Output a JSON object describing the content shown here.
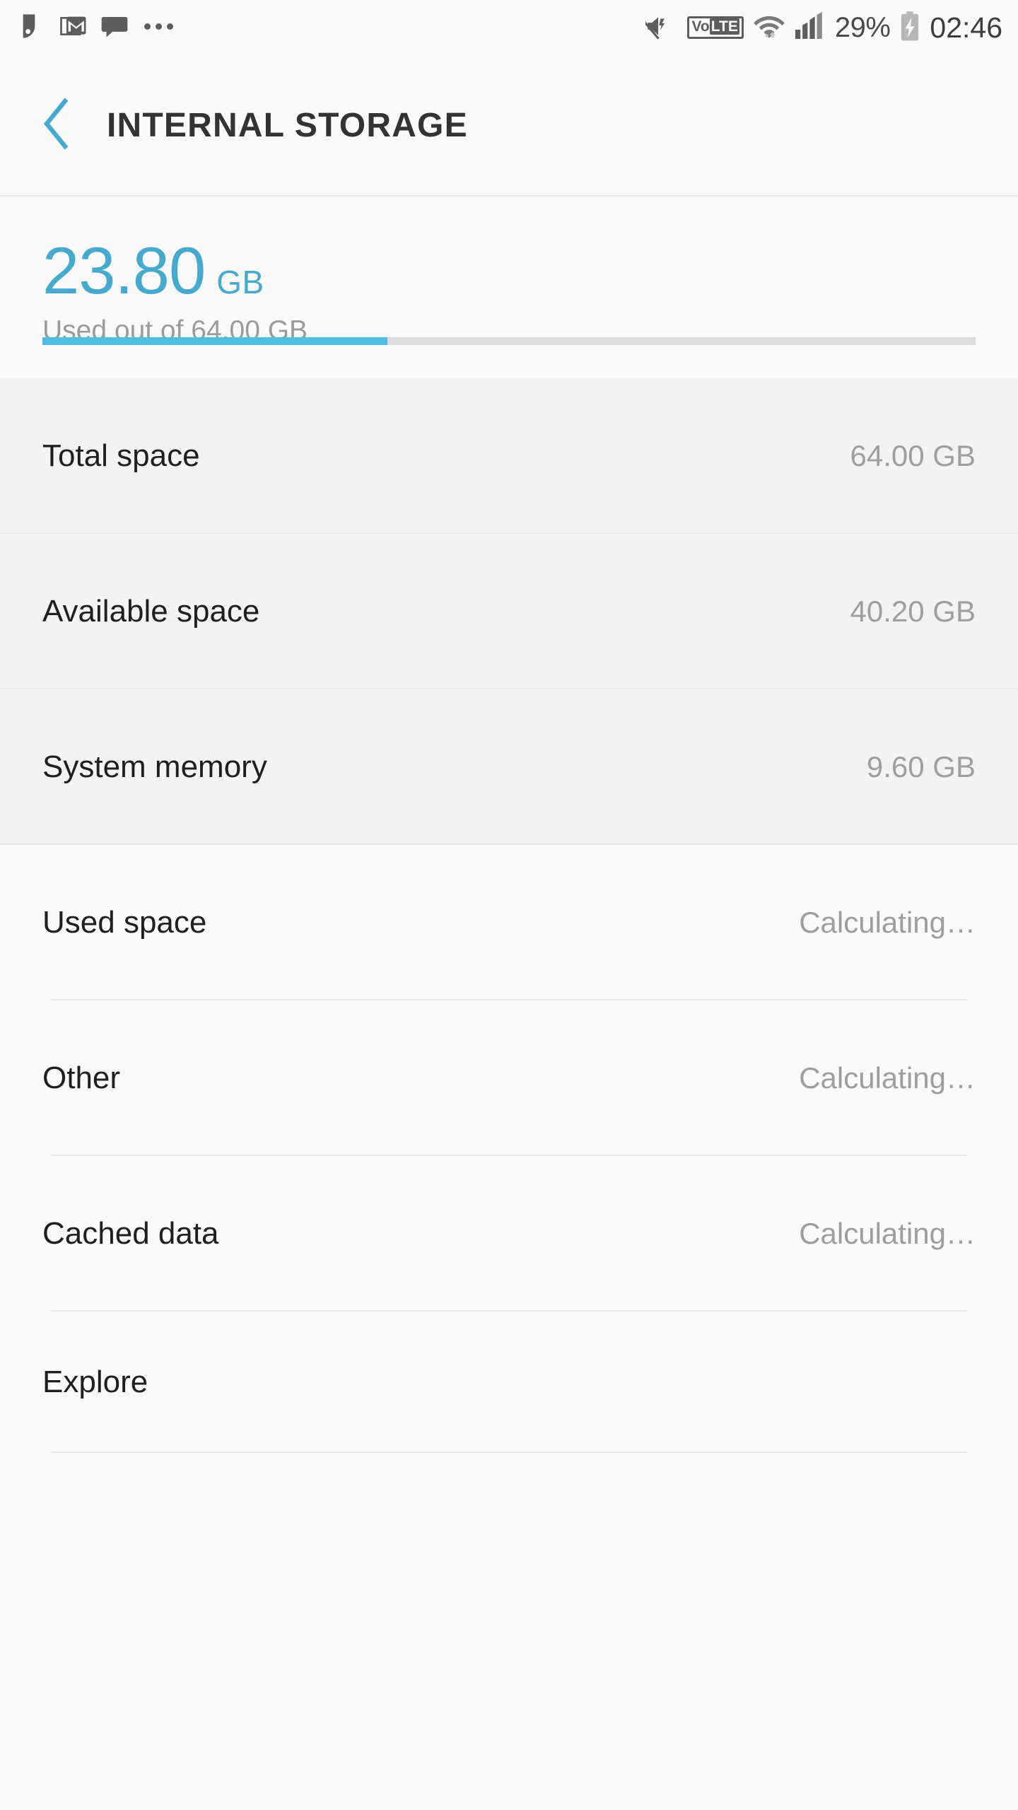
{
  "status_bar": {
    "left_icons": [
      {
        "name": "alarm-app-icon",
        "glyph": "alarm"
      },
      {
        "name": "gmail-icon",
        "glyph": "mail"
      },
      {
        "name": "messages-icon",
        "glyph": "chat"
      },
      {
        "name": "more-notifications-icon",
        "glyph": "dots"
      }
    ],
    "right_icons": [
      {
        "name": "mute-vibrate-icon",
        "glyph": "mute"
      },
      {
        "name": "volte-icon",
        "glyph": "volte"
      },
      {
        "name": "wifi-icon",
        "glyph": "wifi"
      },
      {
        "name": "cellular-signal-icon",
        "glyph": "signal"
      }
    ],
    "volte_prefix": "Vo",
    "volte_suffix": "LTE",
    "battery_percent": "29%",
    "battery_state": "charging",
    "clock": "02:46"
  },
  "app_bar": {
    "back_label": "Back",
    "title": "INTERNAL STORAGE"
  },
  "summary": {
    "used_value": "23.80",
    "used_unit": "GB",
    "caption": "Used out of 64.00 GB",
    "progress_percent": 37,
    "accent_color": "#45aace",
    "track_color": "#dcdcdc"
  },
  "list": {
    "group_shaded": [
      {
        "label": "Total space",
        "value": "64.00 GB"
      },
      {
        "label": "Available space",
        "value": "40.20 GB"
      },
      {
        "label": "System memory",
        "value": "9.60 GB"
      }
    ],
    "group_plain": [
      {
        "label": "Used space",
        "value": "Calculating…"
      },
      {
        "label": "Other",
        "value": "Calculating…"
      },
      {
        "label": "Cached data",
        "value": "Calculating…"
      },
      {
        "label": "Explore",
        "value": ""
      }
    ]
  }
}
